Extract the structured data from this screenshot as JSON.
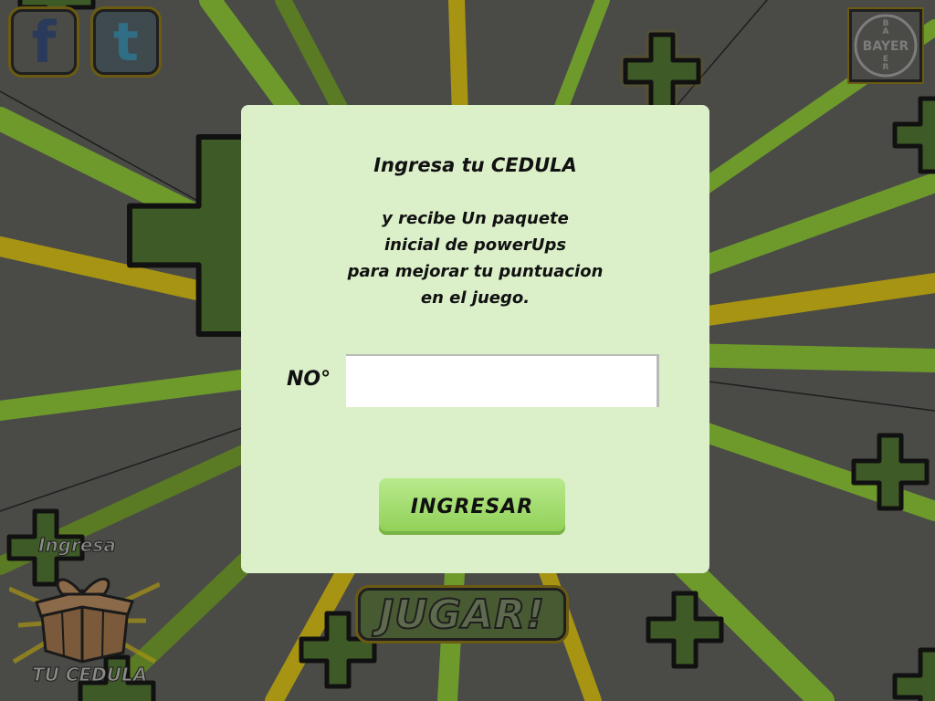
{
  "social": {
    "facebook_glyph": "f",
    "twitter_glyph": "t"
  },
  "brand": {
    "logo_text_h": "BAYER",
    "logo_text_v": "BAYER"
  },
  "play_button": {
    "label": "JUGAR!"
  },
  "gift_badge": {
    "top_text": "Ingresa",
    "bottom_text": "TU CEDULA"
  },
  "modal": {
    "title": "Ingresa tu CEDULA",
    "body": "y recibe Un paquete\ninicial de powerUps\npara mejorar tu puntuacion\nen el juego.",
    "number_label": "NO°",
    "input": {
      "value": "",
      "placeholder": ""
    },
    "submit_label": "INGRESAR"
  },
  "colors": {
    "background": "#4a4b47",
    "modal_bg": "#dbf0c9",
    "button_green": "#9bd964",
    "ray_green": "#6e9a2c",
    "ray_yellow": "#a89413",
    "cross_green": "#3e5a26"
  }
}
